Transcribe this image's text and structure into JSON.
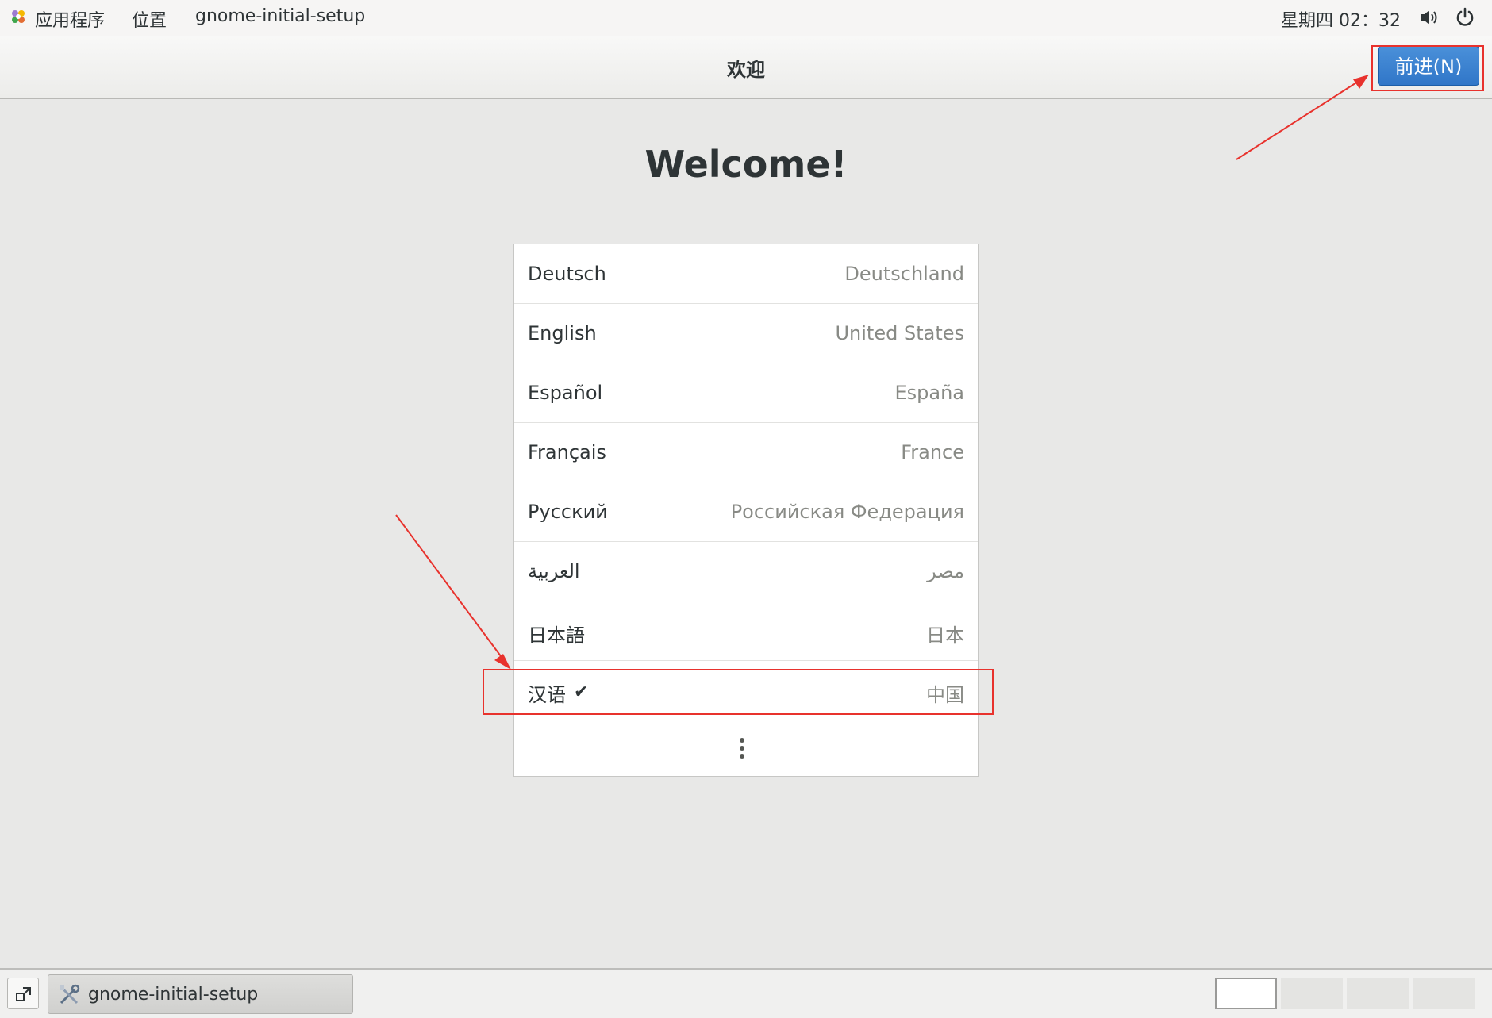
{
  "top_panel": {
    "applications": "应用程序",
    "places": "位置",
    "window_title": "gnome-initial-setup",
    "clock": "星期四 02：32"
  },
  "header": {
    "title": "欢迎",
    "next_button": "前进(N)"
  },
  "main": {
    "welcome": "Welcome!",
    "languages": [
      {
        "name": "Deutsch",
        "region": "Deutschland",
        "selected": false
      },
      {
        "name": "English",
        "region": "United States",
        "selected": false
      },
      {
        "name": "Español",
        "region": "España",
        "selected": false
      },
      {
        "name": "Français",
        "region": "France",
        "selected": false
      },
      {
        "name": "Русский",
        "region": "Российская Федерация",
        "selected": false
      },
      {
        "name": "العربية",
        "region": "مصر",
        "selected": false
      },
      {
        "name": "日本語",
        "region": "日本",
        "selected": false
      },
      {
        "name": "汉语",
        "region": "中国",
        "selected": true
      }
    ],
    "check_mark": "✔",
    "more_icon": "more-vertical-icon"
  },
  "bottom_panel": {
    "task_label": "gnome-initial-setup",
    "workspaces": 4,
    "active_workspace": 1
  },
  "colors": {
    "accent": "#3a80d0",
    "annotation": "#e8322d",
    "background": "#e8e8e7"
  }
}
